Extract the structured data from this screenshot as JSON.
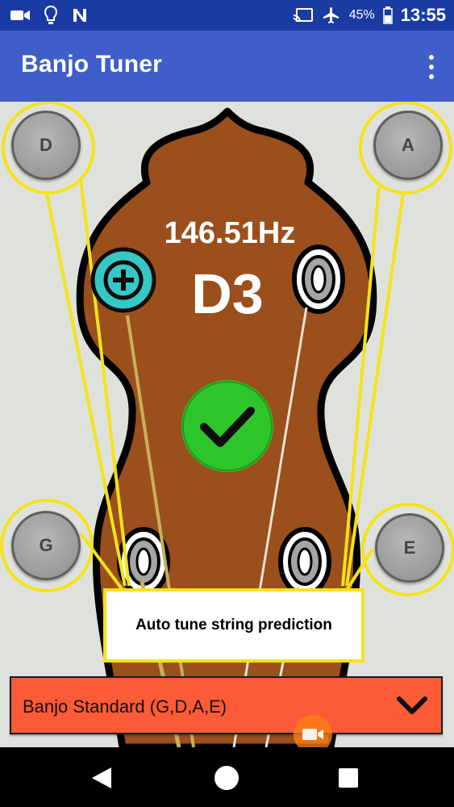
{
  "status_bar": {
    "icons_left": [
      "video-camera-icon",
      "lightbulb-icon",
      "n-app-icon"
    ],
    "icons_right": [
      "cast-icon",
      "airplane-icon"
    ],
    "battery": "45%",
    "time": "13:55"
  },
  "app_bar": {
    "title": "Banjo Tuner",
    "menu_icon": "overflow-menu-icon"
  },
  "tuner": {
    "frequency": "146.51Hz",
    "note": "D3",
    "in_tune_icon": "checkmark-icon",
    "add_icon": "plus-circle-icon",
    "pegs": {
      "top_left": "D",
      "top_right": "A",
      "bottom_left": "G",
      "bottom_right": "E"
    },
    "callout": "Auto tune string prediction"
  },
  "tuning_select": {
    "selected": "Banjo Standard (G,D,A,E)",
    "arrow_icon": "chevron-down-icon"
  },
  "fab": {
    "icon": "video-camera-icon"
  },
  "nav_bar": {
    "icons": [
      "back-triangle-icon",
      "home-circle-icon",
      "recents-square-icon"
    ]
  },
  "colors": {
    "status_bar": "#1a3ba3",
    "app_bar": "#3f5ec9",
    "background": "#dfe2dc",
    "headstock": "#9b4f1c",
    "highlight_yellow": "#f5e21a",
    "check_green": "#2ec52a",
    "plus_teal": "#37c7c4",
    "dropdown": "#fd5a37"
  }
}
